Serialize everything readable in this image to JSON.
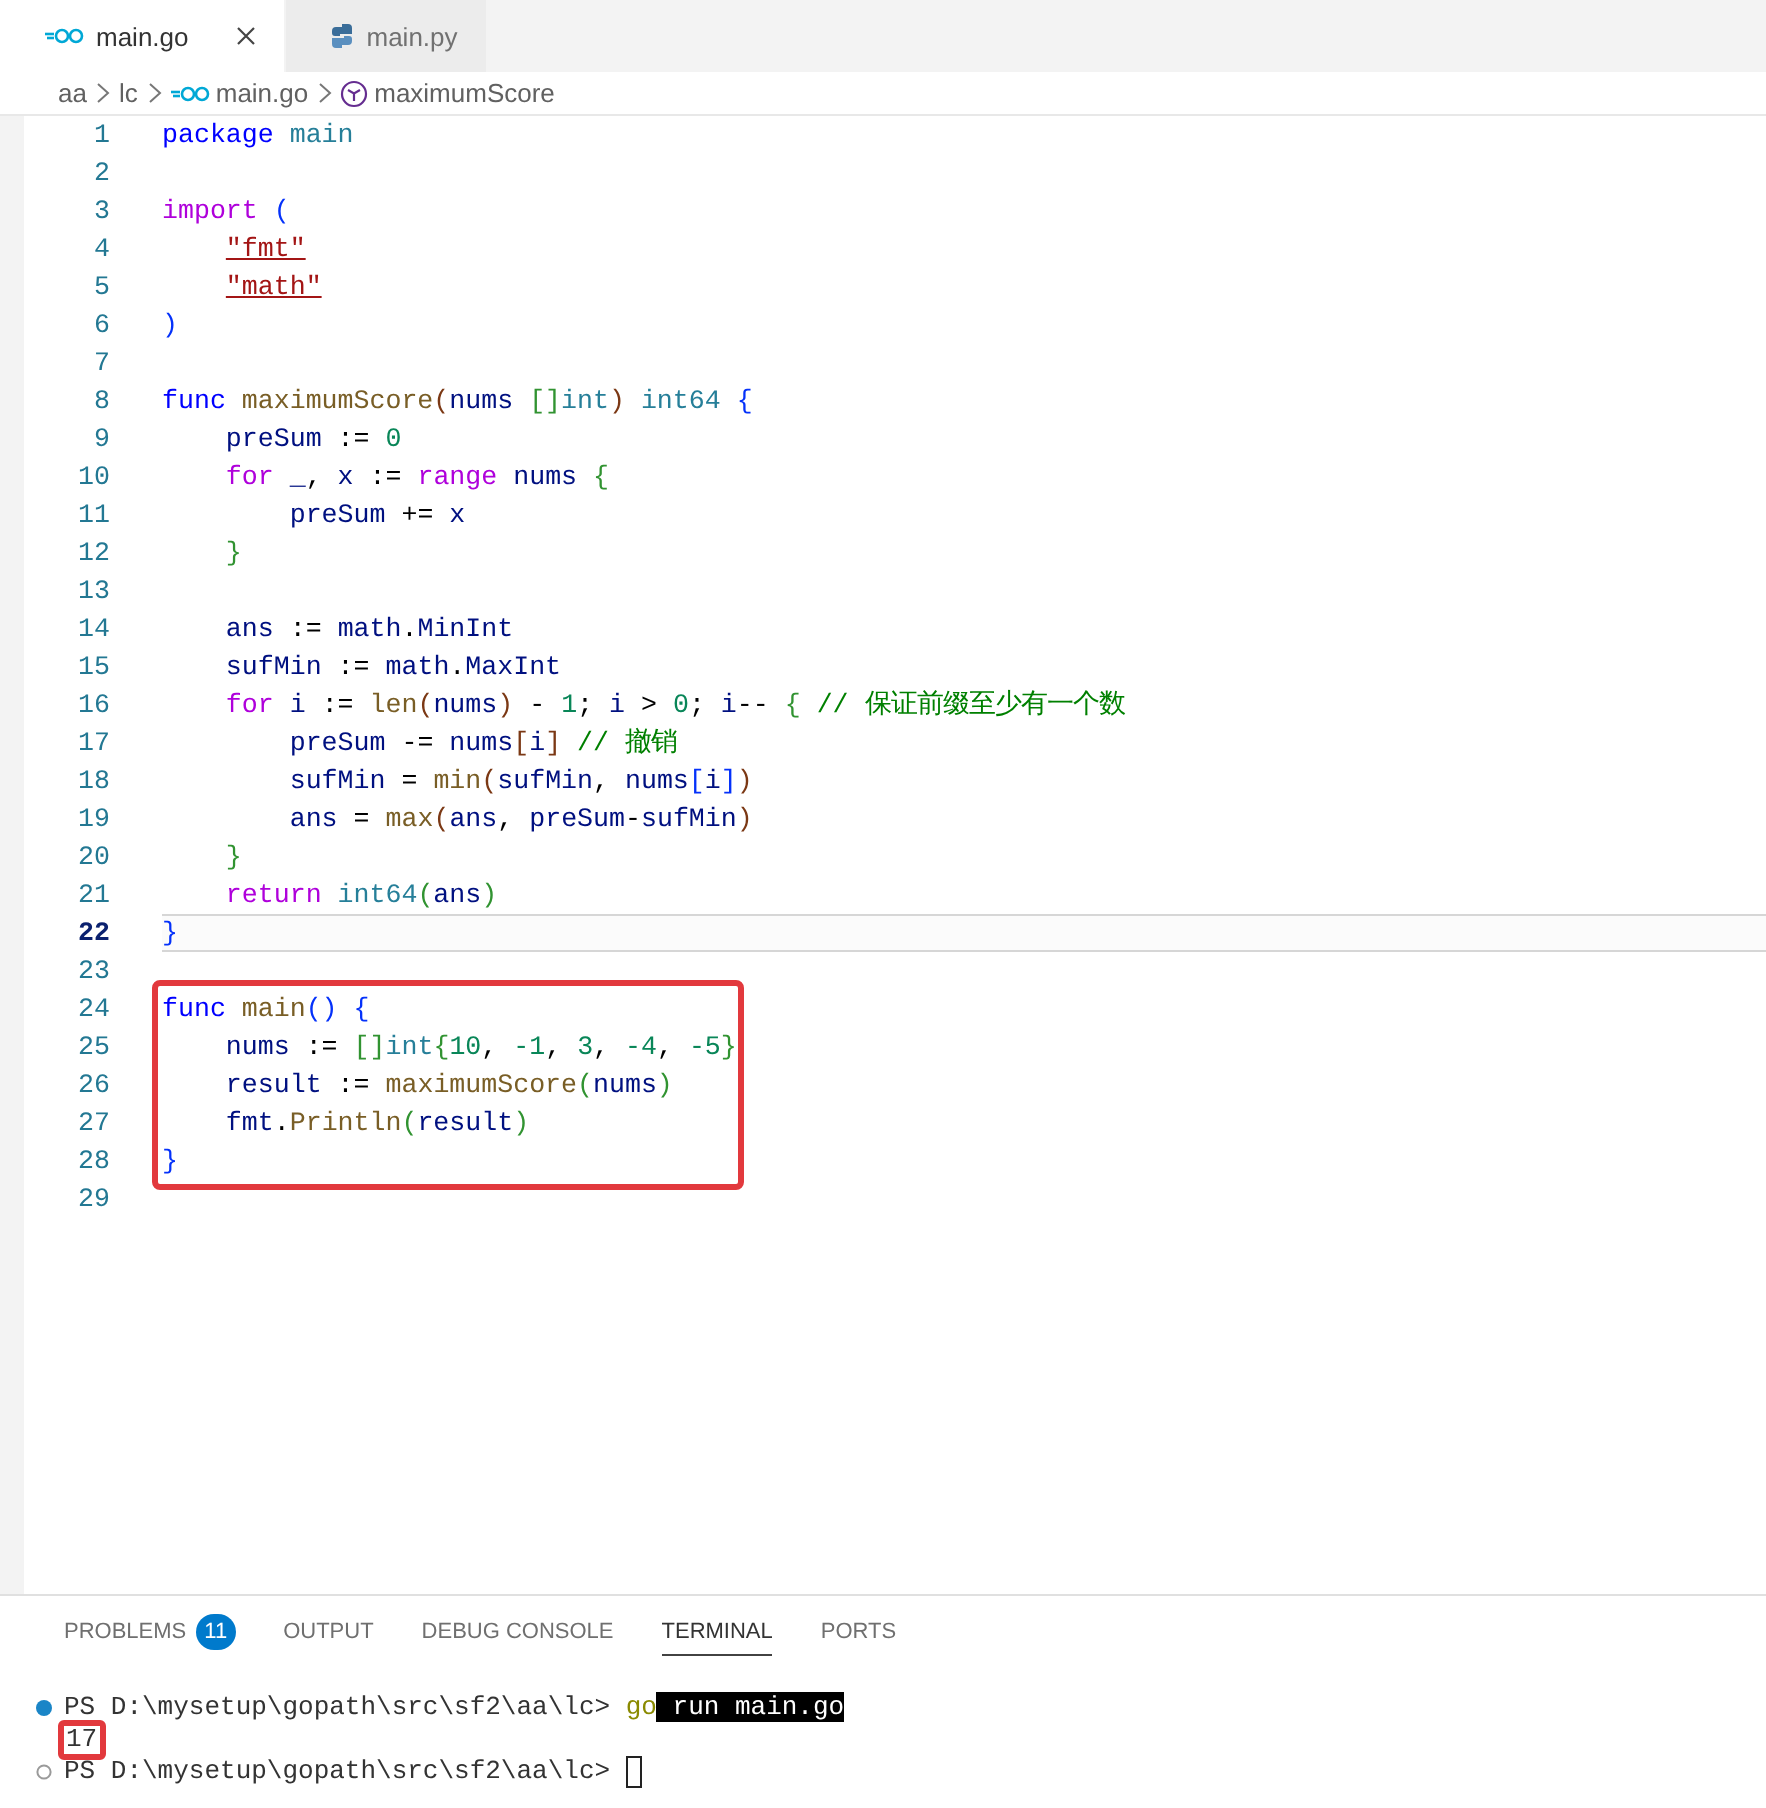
{
  "tabs": [
    {
      "label": "main.go",
      "kind": "go",
      "selected": true
    },
    {
      "label": "main.py",
      "kind": "python",
      "selected": false
    }
  ],
  "breadcrumb": [
    {
      "label": "aa",
      "kind": "folder"
    },
    {
      "label": "lc",
      "kind": "folder"
    },
    {
      "label": "main.go",
      "kind": "go"
    },
    {
      "label": "maximumScore",
      "kind": "symbol"
    }
  ],
  "editor": {
    "blocks": [
      {
        "boxed": false,
        "lines": [
          {
            "number": "1",
            "current": false,
            "tokens": [
              {
                "kind": "kw",
                "text": "package "
              },
              {
                "kind": "type",
                "text": "main"
              }
            ]
          },
          {
            "number": "2",
            "current": false
          },
          {
            "number": "3",
            "current": false,
            "tokens": [
              {
                "kind": "ctrl",
                "text": "import "
              },
              {
                "kind": "b1",
                "text": "("
              }
            ]
          },
          {
            "number": "4",
            "current": false,
            "tokens": [
              {
                "kind": "imp",
                "text": "    \"fmt\""
              }
            ]
          },
          {
            "number": "5",
            "current": false,
            "tokens": [
              {
                "kind": "imp",
                "text": "    \"math\""
              }
            ]
          },
          {
            "number": "6",
            "current": false,
            "tokens": [
              {
                "kind": "b1",
                "text": ")"
              }
            ]
          },
          {
            "number": "7",
            "current": false
          },
          {
            "number": "8",
            "current": false,
            "tokens": [
              {
                "kind": "kw",
                "text": "func "
              },
              {
                "kind": "fn",
                "text": "maximumScore"
              },
              {
                "kind": "b3",
                "text": "("
              },
              {
                "kind": "var",
                "text": "nums "
              },
              {
                "kind": "b2",
                "text": "[]"
              },
              {
                "kind": "type",
                "text": "int"
              },
              {
                "kind": "b3",
                "text": ") "
              },
              {
                "kind": "type",
                "text": "int64 "
              },
              {
                "kind": "b1",
                "text": "{"
              }
            ]
          },
          {
            "number": "9",
            "current": false,
            "tokens": [
              {
                "kind": "var",
                "text": "    preSum"
              },
              {
                "kind": "p",
                "text": " := "
              },
              {
                "kind": "num",
                "text": "0"
              }
            ]
          },
          {
            "number": "10",
            "current": false,
            "tokens": [
              {
                "kind": "ctrl",
                "text": "    for "
              },
              {
                "kind": "var",
                "text": "_"
              },
              {
                "kind": "p",
                "text": ", "
              },
              {
                "kind": "var",
                "text": "x"
              },
              {
                "kind": "p",
                "text": " := "
              },
              {
                "kind": "ctrl",
                "text": "range "
              },
              {
                "kind": "var",
                "text": "nums "
              },
              {
                "kind": "b2",
                "text": "{"
              }
            ]
          },
          {
            "number": "11",
            "current": false,
            "tokens": [
              {
                "kind": "var",
                "text": "        preSum"
              },
              {
                "kind": "p",
                "text": " += "
              },
              {
                "kind": "var",
                "text": "x"
              }
            ]
          },
          {
            "number": "12",
            "current": false,
            "tokens": [
              {
                "kind": "b2",
                "text": "    }"
              }
            ]
          },
          {
            "number": "13",
            "current": false
          },
          {
            "number": "14",
            "current": false,
            "tokens": [
              {
                "kind": "var",
                "text": "    ans"
              },
              {
                "kind": "p",
                "text": " := "
              },
              {
                "kind": "var",
                "text": "math"
              },
              {
                "kind": "p",
                "text": "."
              },
              {
                "kind": "var",
                "text": "MinInt"
              }
            ]
          },
          {
            "number": "15",
            "current": false,
            "tokens": [
              {
                "kind": "var",
                "text": "    sufMin"
              },
              {
                "kind": "p",
                "text": " := "
              },
              {
                "kind": "var",
                "text": "math"
              },
              {
                "kind": "p",
                "text": "."
              },
              {
                "kind": "var",
                "text": "MaxInt"
              }
            ]
          },
          {
            "number": "16",
            "current": false,
            "tokens": [
              {
                "kind": "ctrl",
                "text": "    for "
              },
              {
                "kind": "var",
                "text": "i"
              },
              {
                "kind": "p",
                "text": " := "
              },
              {
                "kind": "fn",
                "text": "len"
              },
              {
                "kind": "b3",
                "text": "("
              },
              {
                "kind": "var",
                "text": "nums"
              },
              {
                "kind": "b3",
                "text": ")"
              },
              {
                "kind": "p",
                "text": " - "
              },
              {
                "kind": "num",
                "text": "1"
              },
              {
                "kind": "p",
                "text": "; "
              },
              {
                "kind": "var",
                "text": "i"
              },
              {
                "kind": "p",
                "text": " > "
              },
              {
                "kind": "num",
                "text": "0"
              },
              {
                "kind": "p",
                "text": "; "
              },
              {
                "kind": "var",
                "text": "i"
              },
              {
                "kind": "p",
                "text": "-- "
              },
              {
                "kind": "b2",
                "text": "{ "
              },
              {
                "kind": "cm",
                "text": "// 保证前缀至少有一个数"
              }
            ]
          },
          {
            "number": "17",
            "current": false,
            "tokens": [
              {
                "kind": "var",
                "text": "        preSum"
              },
              {
                "kind": "p",
                "text": " -= "
              },
              {
                "kind": "var",
                "text": "nums"
              },
              {
                "kind": "b3",
                "text": "["
              },
              {
                "kind": "var",
                "text": "i"
              },
              {
                "kind": "b3",
                "text": "] "
              },
              {
                "kind": "cm",
                "text": "// 撤销"
              }
            ]
          },
          {
            "number": "18",
            "current": false,
            "tokens": [
              {
                "kind": "var",
                "text": "        sufMin"
              },
              {
                "kind": "p",
                "text": " = "
              },
              {
                "kind": "fn",
                "text": "min"
              },
              {
                "kind": "b3",
                "text": "("
              },
              {
                "kind": "var",
                "text": "sufMin"
              },
              {
                "kind": "p",
                "text": ", "
              },
              {
                "kind": "var",
                "text": "nums"
              },
              {
                "kind": "b1",
                "text": "["
              },
              {
                "kind": "var",
                "text": "i"
              },
              {
                "kind": "b1",
                "text": "]"
              },
              {
                "kind": "b3",
                "text": ")"
              }
            ]
          },
          {
            "number": "19",
            "current": false,
            "tokens": [
              {
                "kind": "var",
                "text": "        ans"
              },
              {
                "kind": "p",
                "text": " = "
              },
              {
                "kind": "fn",
                "text": "max"
              },
              {
                "kind": "b3",
                "text": "("
              },
              {
                "kind": "var",
                "text": "ans"
              },
              {
                "kind": "p",
                "text": ", "
              },
              {
                "kind": "var",
                "text": "preSum"
              },
              {
                "kind": "p",
                "text": "-"
              },
              {
                "kind": "var",
                "text": "sufMin"
              },
              {
                "kind": "b3",
                "text": ")"
              }
            ]
          },
          {
            "number": "20",
            "current": false,
            "tokens": [
              {
                "kind": "b2",
                "text": "    }"
              }
            ]
          },
          {
            "number": "21",
            "current": false,
            "tokens": [
              {
                "kind": "ctrl",
                "text": "    return "
              },
              {
                "kind": "type",
                "text": "int64"
              },
              {
                "kind": "b2",
                "text": "("
              },
              {
                "kind": "var",
                "text": "ans"
              },
              {
                "kind": "b2",
                "text": ")"
              }
            ]
          },
          {
            "number": "22",
            "current": true,
            "tokens": [
              {
                "kind": "b1",
                "text": "}"
              }
            ]
          },
          {
            "number": "23",
            "current": false
          }
        ]
      },
      {
        "boxed": true,
        "lines": [
          {
            "number": "24",
            "current": false,
            "tokens": [
              {
                "kind": "kw",
                "text": "func "
              },
              {
                "kind": "fn",
                "text": "main"
              },
              {
                "kind": "b1",
                "text": "() {"
              }
            ]
          },
          {
            "number": "25",
            "current": false,
            "tokens": [
              {
                "kind": "var",
                "text": "    nums"
              },
              {
                "kind": "p",
                "text": " := "
              },
              {
                "kind": "b2",
                "text": "[]"
              },
              {
                "kind": "type",
                "text": "int"
              },
              {
                "kind": "b2",
                "text": "{"
              },
              {
                "kind": "num",
                "text": "10"
              },
              {
                "kind": "p",
                "text": ", "
              },
              {
                "kind": "num",
                "text": "-1"
              },
              {
                "kind": "p",
                "text": ", "
              },
              {
                "kind": "num",
                "text": "3"
              },
              {
                "kind": "p",
                "text": ", "
              },
              {
                "kind": "num",
                "text": "-4"
              },
              {
                "kind": "p",
                "text": ", "
              },
              {
                "kind": "num",
                "text": "-5"
              },
              {
                "kind": "b2",
                "text": "}"
              }
            ]
          },
          {
            "number": "26",
            "current": false,
            "tokens": [
              {
                "kind": "var",
                "text": "    result"
              },
              {
                "kind": "p",
                "text": " := "
              },
              {
                "kind": "fn",
                "text": "maximumScore"
              },
              {
                "kind": "b2",
                "text": "("
              },
              {
                "kind": "var",
                "text": "nums"
              },
              {
                "kind": "b2",
                "text": ")"
              }
            ]
          },
          {
            "number": "27",
            "current": false,
            "tokens": [
              {
                "kind": "var",
                "text": "    fmt"
              },
              {
                "kind": "p",
                "text": "."
              },
              {
                "kind": "fn",
                "text": "Println"
              },
              {
                "kind": "b2",
                "text": "("
              },
              {
                "kind": "var",
                "text": "result"
              },
              {
                "kind": "b2",
                "text": ")"
              }
            ]
          },
          {
            "number": "28",
            "current": false,
            "tokens": [
              {
                "kind": "b1",
                "text": "}"
              }
            ]
          }
        ]
      },
      {
        "boxed": false,
        "lines": [
          {
            "number": "29",
            "current": false
          }
        ]
      }
    ]
  },
  "panel": {
    "tabs": [
      {
        "label": "PROBLEMS",
        "badge": "11",
        "selected": false
      },
      {
        "label": "OUTPUT",
        "selected": false
      },
      {
        "label": "DEBUG CONSOLE",
        "selected": false
      },
      {
        "label": "TERMINAL",
        "selected": true
      },
      {
        "label": "PORTS",
        "selected": false
      }
    ],
    "terminal": [
      {
        "kind": "success",
        "boxed": false,
        "cursor": false,
        "segments": [
          {
            "kind": "prompt",
            "text": "PS D:\\mysetup\\gopath\\src\\sf2\\aa\\lc> "
          },
          {
            "kind": "cmd",
            "text": "go"
          },
          {
            "kind": "sel",
            "text": " run main.go"
          }
        ]
      },
      {
        "kind": "output",
        "boxed": true,
        "cursor": false,
        "segments": [
          {
            "kind": "out",
            "text": "17"
          }
        ]
      },
      {
        "kind": "idle",
        "boxed": false,
        "cursor": true,
        "segments": [
          {
            "kind": "prompt",
            "text": "PS D:\\mysetup\\gopath\\src\\sf2\\aa\\lc> "
          }
        ]
      }
    ]
  }
}
